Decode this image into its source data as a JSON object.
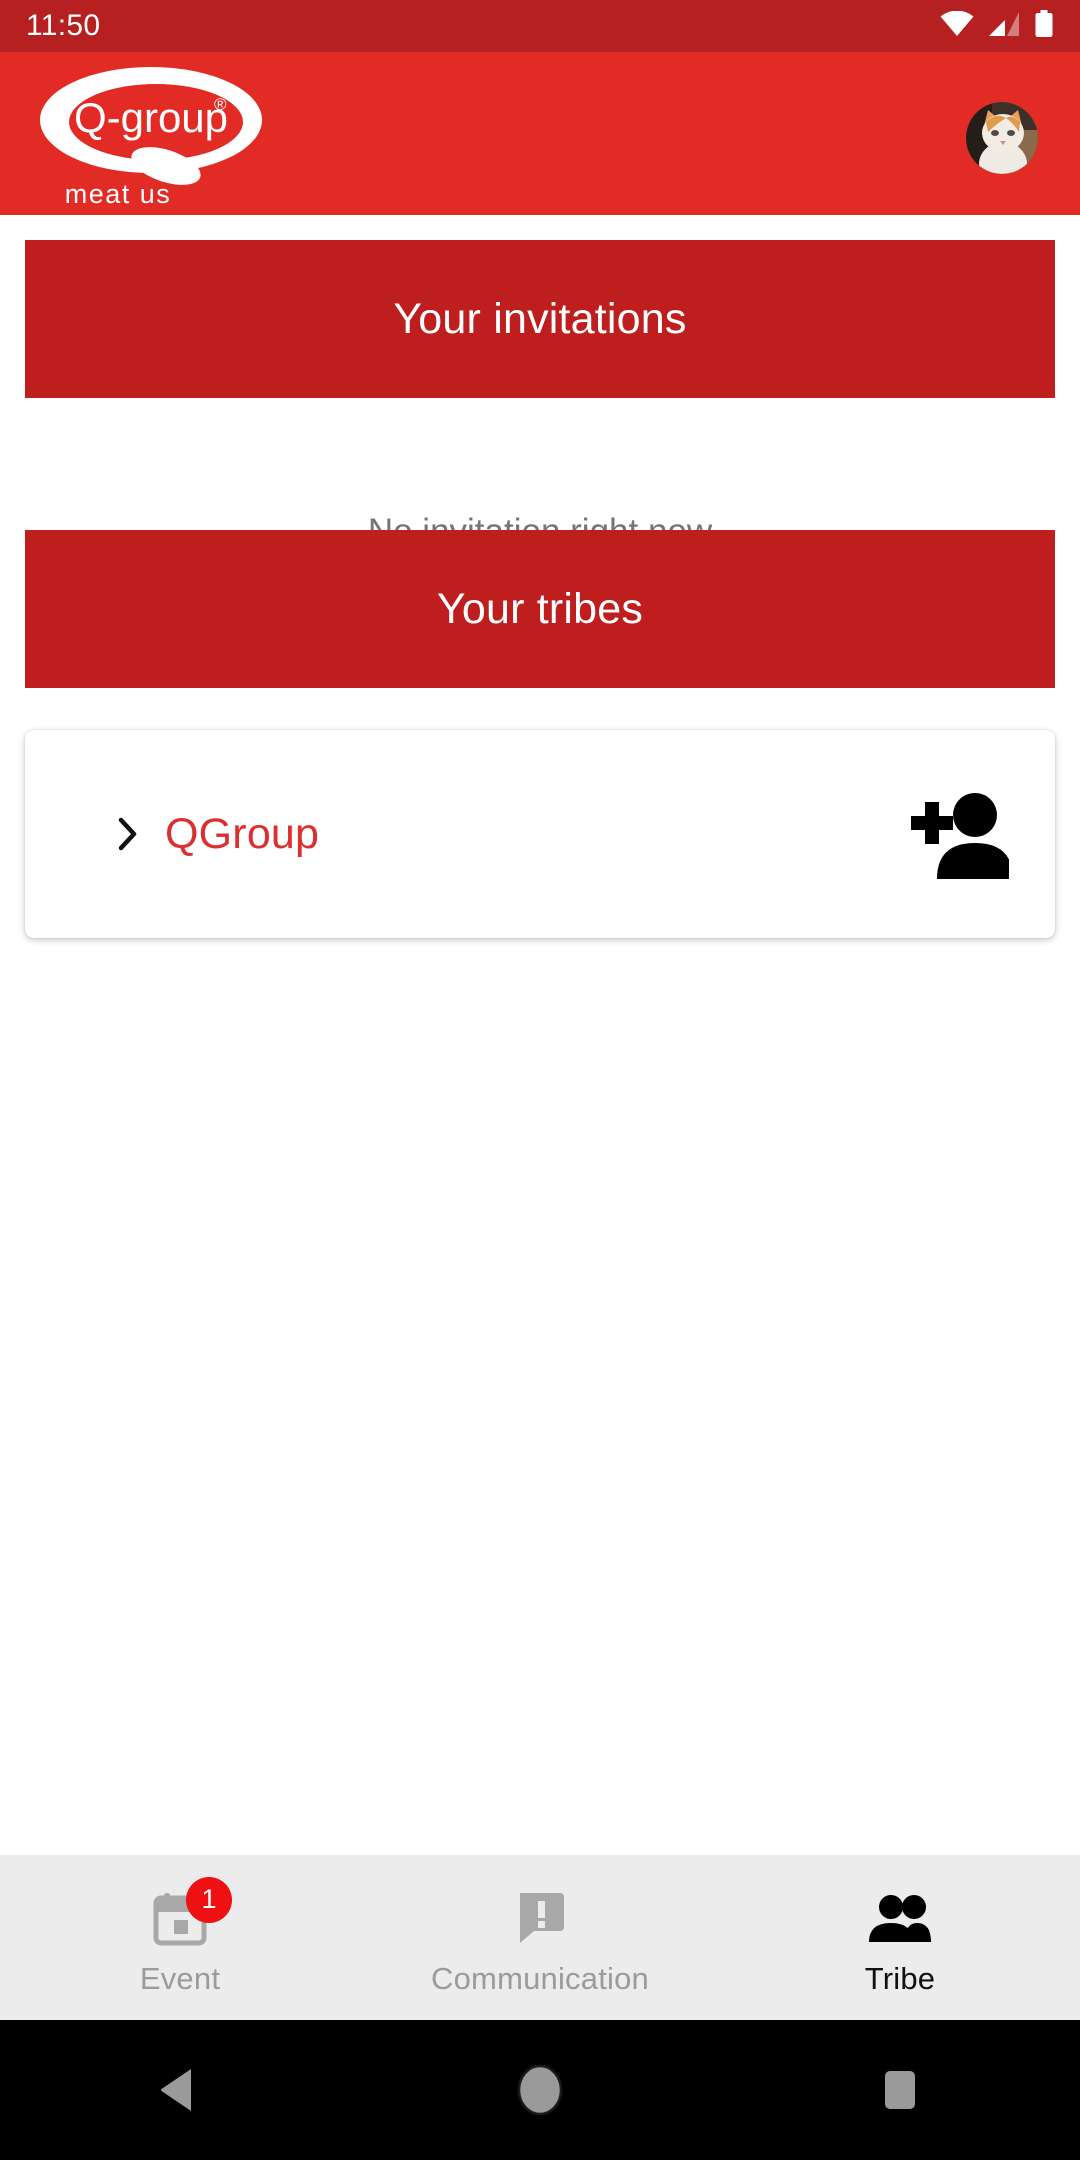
{
  "status_bar": {
    "time": "11:50",
    "icons": [
      "wifi-icon",
      "cellular-signal-icon",
      "battery-icon"
    ],
    "background": "#b62020"
  },
  "app_bar": {
    "background": "#e32b25",
    "logo": {
      "brand": "Q-group",
      "registered_mark": "®",
      "tagline": "meat us"
    },
    "avatar_label": "profile-avatar"
  },
  "main": {
    "invitations": {
      "banner_label": "Your invitations",
      "empty_text": "No invitation right now"
    },
    "tribes": {
      "banner_label": "Your tribes",
      "items": [
        {
          "name": "QGroup",
          "expand_icon": "chevron-right-icon",
          "action_icon": "person-add-icon"
        }
      ]
    }
  },
  "bottom_nav": {
    "items": [
      {
        "label": "Event",
        "icon": "calendar-icon",
        "badge": "1",
        "active": false
      },
      {
        "label": "Communication",
        "icon": "announcement-icon",
        "badge": "",
        "active": false
      },
      {
        "label": "Tribe",
        "icon": "people-icon",
        "badge": "",
        "active": true
      }
    ]
  },
  "system_nav": {
    "back": "back-triangle-icon",
    "home": "home-circle-icon",
    "recents": "recents-square-icon"
  },
  "colors": {
    "brand_red": "#e32b25",
    "banner_red": "#be1e1e",
    "status_red": "#b62020",
    "link_red": "#dc3030",
    "badge_red": "#ef1111",
    "muted_text": "#757575",
    "nav_bg": "#ececec"
  }
}
